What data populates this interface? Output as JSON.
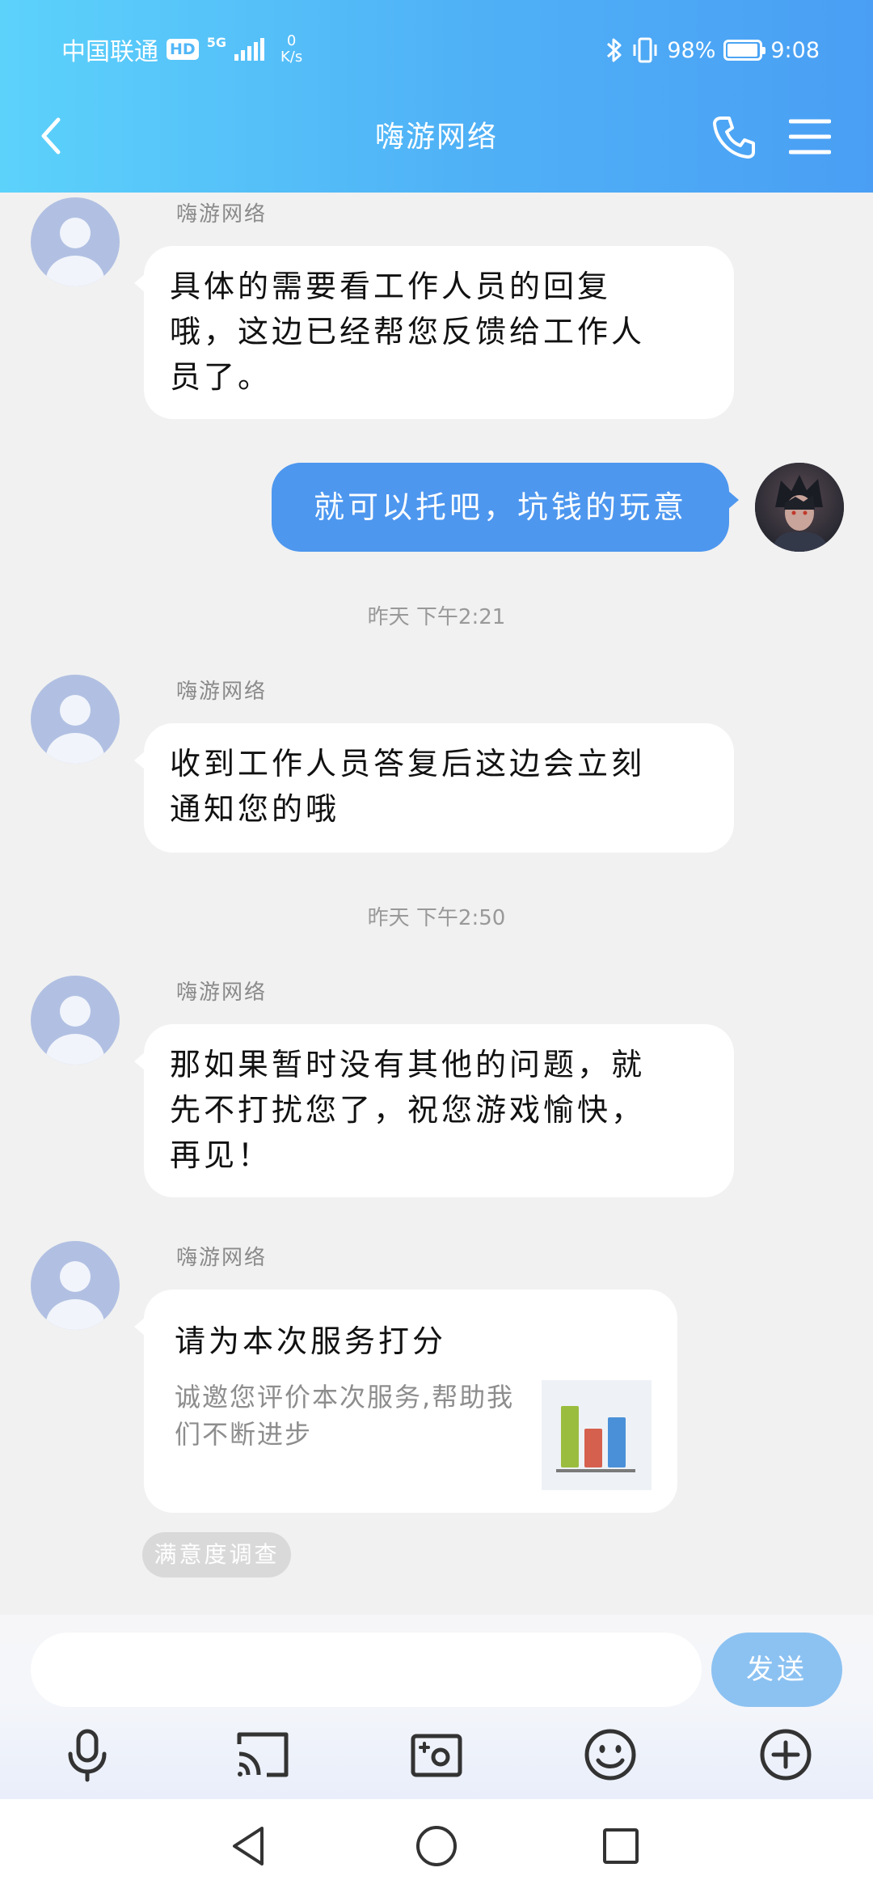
{
  "status_bar": {
    "carrier": "中国联通",
    "hd": "HD",
    "network": "5G",
    "net_speed_value": "0",
    "net_speed_unit": "K/s",
    "battery_percent": "98%",
    "battery_level": 0.98,
    "time": "9:08"
  },
  "header": {
    "title": "嗨游网络"
  },
  "messages": [
    {
      "sender": "嗨游网络",
      "lines": [
        "具体的需要看工作人员的回复",
        "哦，这边已经帮您反馈给工作人",
        "员了。"
      ]
    },
    {
      "self_text": "就可以托吧，坑钱的玩意"
    },
    {
      "timestamp": "昨天 下午2:21"
    },
    {
      "sender": "嗨游网络",
      "lines": [
        "收到工作人员答复后这边会立刻",
        "通知您的哦"
      ]
    },
    {
      "timestamp": "昨天 下午2:50"
    },
    {
      "sender": "嗨游网络",
      "lines": [
        "那如果暂时没有其他的问题，就",
        "先不打扰您了，祝您游戏愉快，",
        "再见！"
      ]
    },
    {
      "sender": "嗨游网络",
      "card_title": "请为本次服务打分",
      "card_desc": "诚邀您评价本次服务,帮助我们不断进步"
    }
  ],
  "survey_chip": "满意度调查",
  "input": {
    "value": "",
    "send_label": "发送"
  },
  "icons": {
    "back": "back-arrow-icon",
    "phone": "phone-icon",
    "menu": "menu-icon",
    "mic": "microphone-icon",
    "cast": "cast-icon",
    "photo": "photo-icon",
    "emoji": "emoji-icon",
    "plus": "plus-icon"
  },
  "colors": {
    "header_start": "#5cd2fb",
    "header_end": "#4a9ff4",
    "self_bubble": "#4d97ef",
    "send_button": "#8cc2f2"
  }
}
